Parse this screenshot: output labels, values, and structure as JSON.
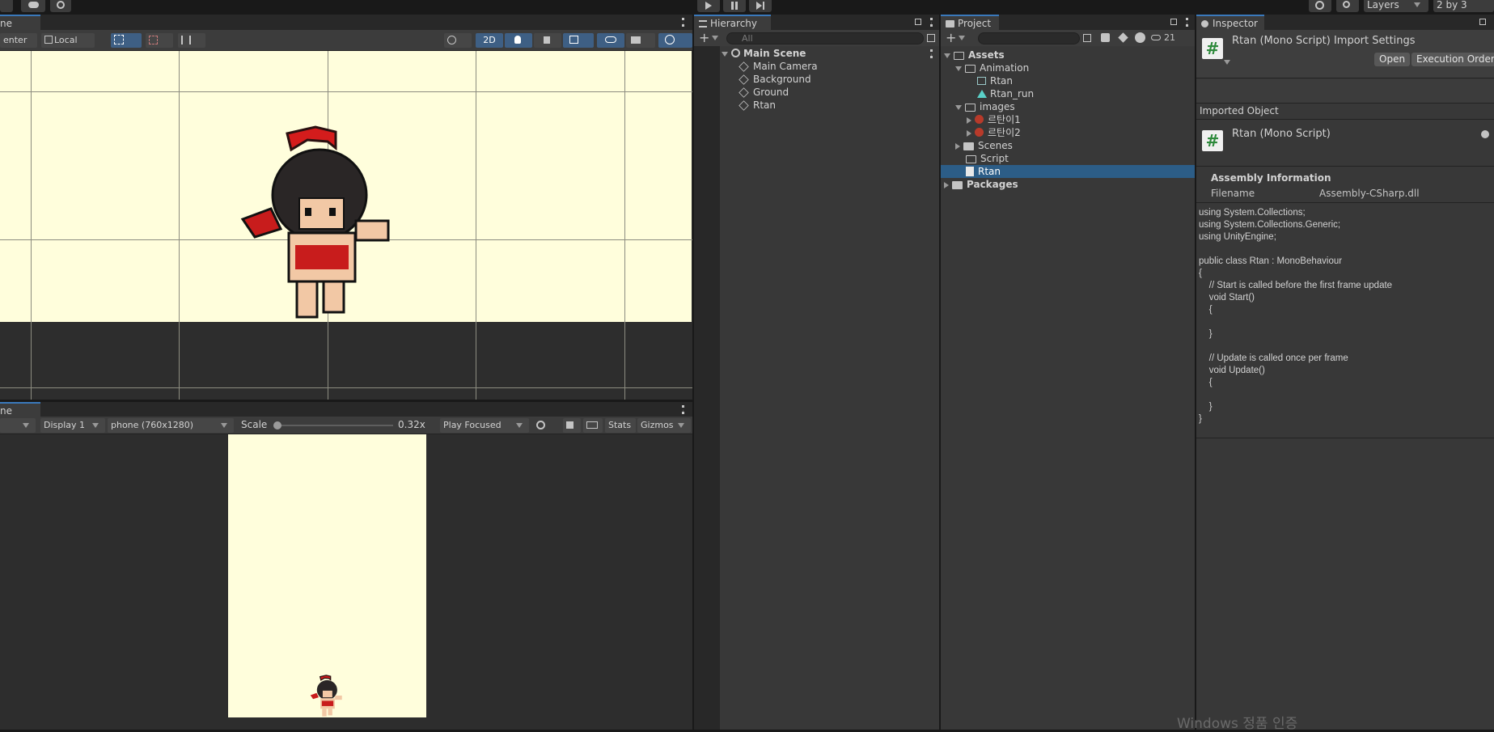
{
  "topbar": {
    "layers_label": "Layers",
    "layout_label": "2 by 3"
  },
  "scene": {
    "tab_label": "ne",
    "pivot_label": "enter",
    "space_label": "Local",
    "mode_2d_label": "2D"
  },
  "game": {
    "tab_label": "ne",
    "display_label": "Display 1",
    "resolution_label": "phone (760x1280)",
    "scale_label": "Scale",
    "scale_value": "0.32x",
    "play_mode_label": "Play Focused",
    "stats_label": "Stats",
    "gizmos_label": "Gizmos"
  },
  "hierarchy": {
    "tab_label": "Hierarchy",
    "search_placeholder": "All",
    "scene_name": "Main Scene",
    "items": [
      "Main Camera",
      "Background",
      "Ground",
      "Rtan"
    ]
  },
  "project": {
    "tab_label": "Project",
    "hidden_count": "21",
    "root": "Assets",
    "animation_folder": "Animation",
    "animation_items": [
      "Rtan",
      "Rtan_run"
    ],
    "images_folder": "images",
    "image_items": [
      "르탄이1",
      "르탄이2"
    ],
    "scenes_folder": "Scenes",
    "script_folder": "Script",
    "selected_item": "Rtan",
    "packages": "Packages"
  },
  "inspector": {
    "tab_label": "Inspector",
    "title": "Rtan (Mono Script) Import Settings",
    "open_label": "Open",
    "exec_order_label": "Execution Order...",
    "imported_object_label": "Imported Object",
    "object_name": "Rtan (Mono Script)",
    "assembly_header": "Assembly Information",
    "filename_label": "Filename",
    "filename_value": "Assembly-CSharp.dll",
    "code": "using System.Collections;\nusing System.Collections.Generic;\nusing UnityEngine;\n\npublic class Rtan : MonoBehaviour\n{\n    // Start is called before the first frame update\n    void Start()\n    {\n\n    }\n\n    // Update is called once per frame\n    void Update()\n    {\n\n    }\n}"
  },
  "watermark": "Windows 정품 인증",
  "colors": {
    "accent": "#3a79bb",
    "selection": "#2c5d87",
    "camera_bg": "#fffedc"
  }
}
